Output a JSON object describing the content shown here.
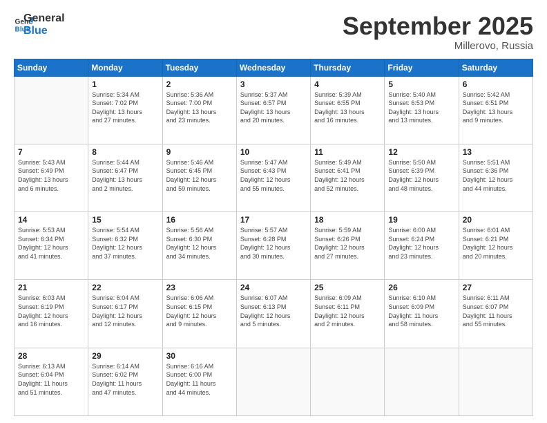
{
  "logo": {
    "line1": "General",
    "line2": "Blue"
  },
  "header": {
    "month": "September 2025",
    "location": "Millerovo, Russia"
  },
  "weekdays": [
    "Sunday",
    "Monday",
    "Tuesday",
    "Wednesday",
    "Thursday",
    "Friday",
    "Saturday"
  ],
  "weeks": [
    [
      {
        "day": "",
        "info": ""
      },
      {
        "day": "1",
        "info": "Sunrise: 5:34 AM\nSunset: 7:02 PM\nDaylight: 13 hours\nand 27 minutes."
      },
      {
        "day": "2",
        "info": "Sunrise: 5:36 AM\nSunset: 7:00 PM\nDaylight: 13 hours\nand 23 minutes."
      },
      {
        "day": "3",
        "info": "Sunrise: 5:37 AM\nSunset: 6:57 PM\nDaylight: 13 hours\nand 20 minutes."
      },
      {
        "day": "4",
        "info": "Sunrise: 5:39 AM\nSunset: 6:55 PM\nDaylight: 13 hours\nand 16 minutes."
      },
      {
        "day": "5",
        "info": "Sunrise: 5:40 AM\nSunset: 6:53 PM\nDaylight: 13 hours\nand 13 minutes."
      },
      {
        "day": "6",
        "info": "Sunrise: 5:42 AM\nSunset: 6:51 PM\nDaylight: 13 hours\nand 9 minutes."
      }
    ],
    [
      {
        "day": "7",
        "info": "Sunrise: 5:43 AM\nSunset: 6:49 PM\nDaylight: 13 hours\nand 6 minutes."
      },
      {
        "day": "8",
        "info": "Sunrise: 5:44 AM\nSunset: 6:47 PM\nDaylight: 13 hours\nand 2 minutes."
      },
      {
        "day": "9",
        "info": "Sunrise: 5:46 AM\nSunset: 6:45 PM\nDaylight: 12 hours\nand 59 minutes."
      },
      {
        "day": "10",
        "info": "Sunrise: 5:47 AM\nSunset: 6:43 PM\nDaylight: 12 hours\nand 55 minutes."
      },
      {
        "day": "11",
        "info": "Sunrise: 5:49 AM\nSunset: 6:41 PM\nDaylight: 12 hours\nand 52 minutes."
      },
      {
        "day": "12",
        "info": "Sunrise: 5:50 AM\nSunset: 6:39 PM\nDaylight: 12 hours\nand 48 minutes."
      },
      {
        "day": "13",
        "info": "Sunrise: 5:51 AM\nSunset: 6:36 PM\nDaylight: 12 hours\nand 44 minutes."
      }
    ],
    [
      {
        "day": "14",
        "info": "Sunrise: 5:53 AM\nSunset: 6:34 PM\nDaylight: 12 hours\nand 41 minutes."
      },
      {
        "day": "15",
        "info": "Sunrise: 5:54 AM\nSunset: 6:32 PM\nDaylight: 12 hours\nand 37 minutes."
      },
      {
        "day": "16",
        "info": "Sunrise: 5:56 AM\nSunset: 6:30 PM\nDaylight: 12 hours\nand 34 minutes."
      },
      {
        "day": "17",
        "info": "Sunrise: 5:57 AM\nSunset: 6:28 PM\nDaylight: 12 hours\nand 30 minutes."
      },
      {
        "day": "18",
        "info": "Sunrise: 5:59 AM\nSunset: 6:26 PM\nDaylight: 12 hours\nand 27 minutes."
      },
      {
        "day": "19",
        "info": "Sunrise: 6:00 AM\nSunset: 6:24 PM\nDaylight: 12 hours\nand 23 minutes."
      },
      {
        "day": "20",
        "info": "Sunrise: 6:01 AM\nSunset: 6:21 PM\nDaylight: 12 hours\nand 20 minutes."
      }
    ],
    [
      {
        "day": "21",
        "info": "Sunrise: 6:03 AM\nSunset: 6:19 PM\nDaylight: 12 hours\nand 16 minutes."
      },
      {
        "day": "22",
        "info": "Sunrise: 6:04 AM\nSunset: 6:17 PM\nDaylight: 12 hours\nand 12 minutes."
      },
      {
        "day": "23",
        "info": "Sunrise: 6:06 AM\nSunset: 6:15 PM\nDaylight: 12 hours\nand 9 minutes."
      },
      {
        "day": "24",
        "info": "Sunrise: 6:07 AM\nSunset: 6:13 PM\nDaylight: 12 hours\nand 5 minutes."
      },
      {
        "day": "25",
        "info": "Sunrise: 6:09 AM\nSunset: 6:11 PM\nDaylight: 12 hours\nand 2 minutes."
      },
      {
        "day": "26",
        "info": "Sunrise: 6:10 AM\nSunset: 6:09 PM\nDaylight: 11 hours\nand 58 minutes."
      },
      {
        "day": "27",
        "info": "Sunrise: 6:11 AM\nSunset: 6:07 PM\nDaylight: 11 hours\nand 55 minutes."
      }
    ],
    [
      {
        "day": "28",
        "info": "Sunrise: 6:13 AM\nSunset: 6:04 PM\nDaylight: 11 hours\nand 51 minutes."
      },
      {
        "day": "29",
        "info": "Sunrise: 6:14 AM\nSunset: 6:02 PM\nDaylight: 11 hours\nand 47 minutes."
      },
      {
        "day": "30",
        "info": "Sunrise: 6:16 AM\nSunset: 6:00 PM\nDaylight: 11 hours\nand 44 minutes."
      },
      {
        "day": "",
        "info": ""
      },
      {
        "day": "",
        "info": ""
      },
      {
        "day": "",
        "info": ""
      },
      {
        "day": "",
        "info": ""
      }
    ]
  ]
}
